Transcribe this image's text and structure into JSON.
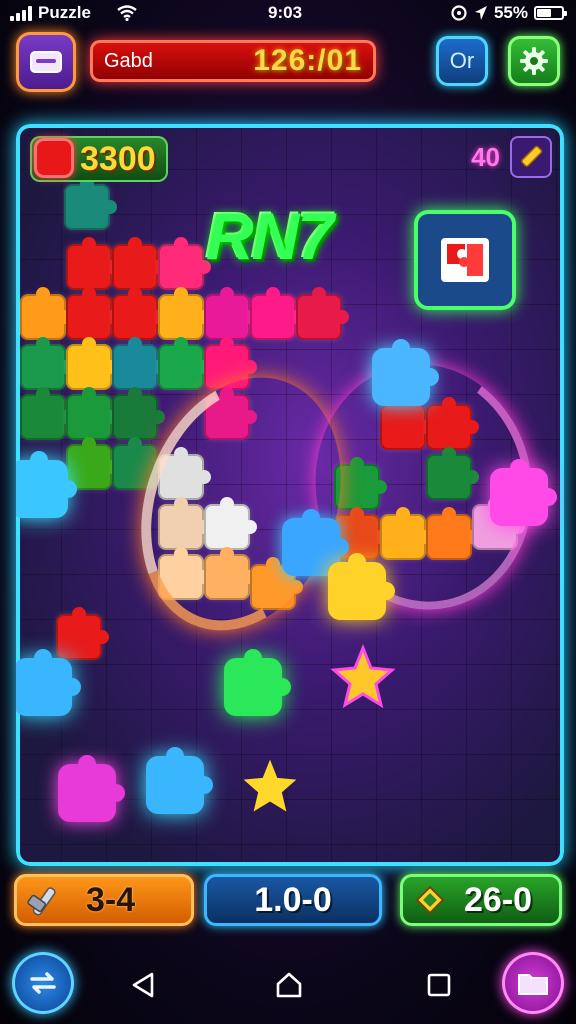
{
  "status_bar": {
    "carrier": "Puzzle",
    "time": "9:03",
    "battery_percent": "55%",
    "battery_level": 0.55
  },
  "hud": {
    "menu_icon": "menu-card-icon",
    "banner_label": "Gabd",
    "banner_value": "126:/01",
    "hint_label": "Or",
    "settings_icon": "gear-icon"
  },
  "board": {
    "coins": "3300",
    "moves": "40",
    "combo_text": "RN7",
    "preview_icon": "puzzle-piece-icon"
  },
  "bottom_stats": {
    "left_value": "3-4",
    "mid_value": "1.0-0",
    "right_value": "26-0",
    "left_icon": "hammer-icon",
    "right_icon": "gem-icon"
  },
  "nav": {
    "left_icon": "swap-icon",
    "back_icon": "back-icon",
    "home_icon": "home-icon",
    "recent_icon": "recent-apps-icon",
    "right_icon": "folder-icon"
  },
  "colors": {
    "board_border": "#3fe0ff",
    "combo": "#33ff55",
    "banner": "#e01010",
    "coins_text": "#ffd93a"
  }
}
